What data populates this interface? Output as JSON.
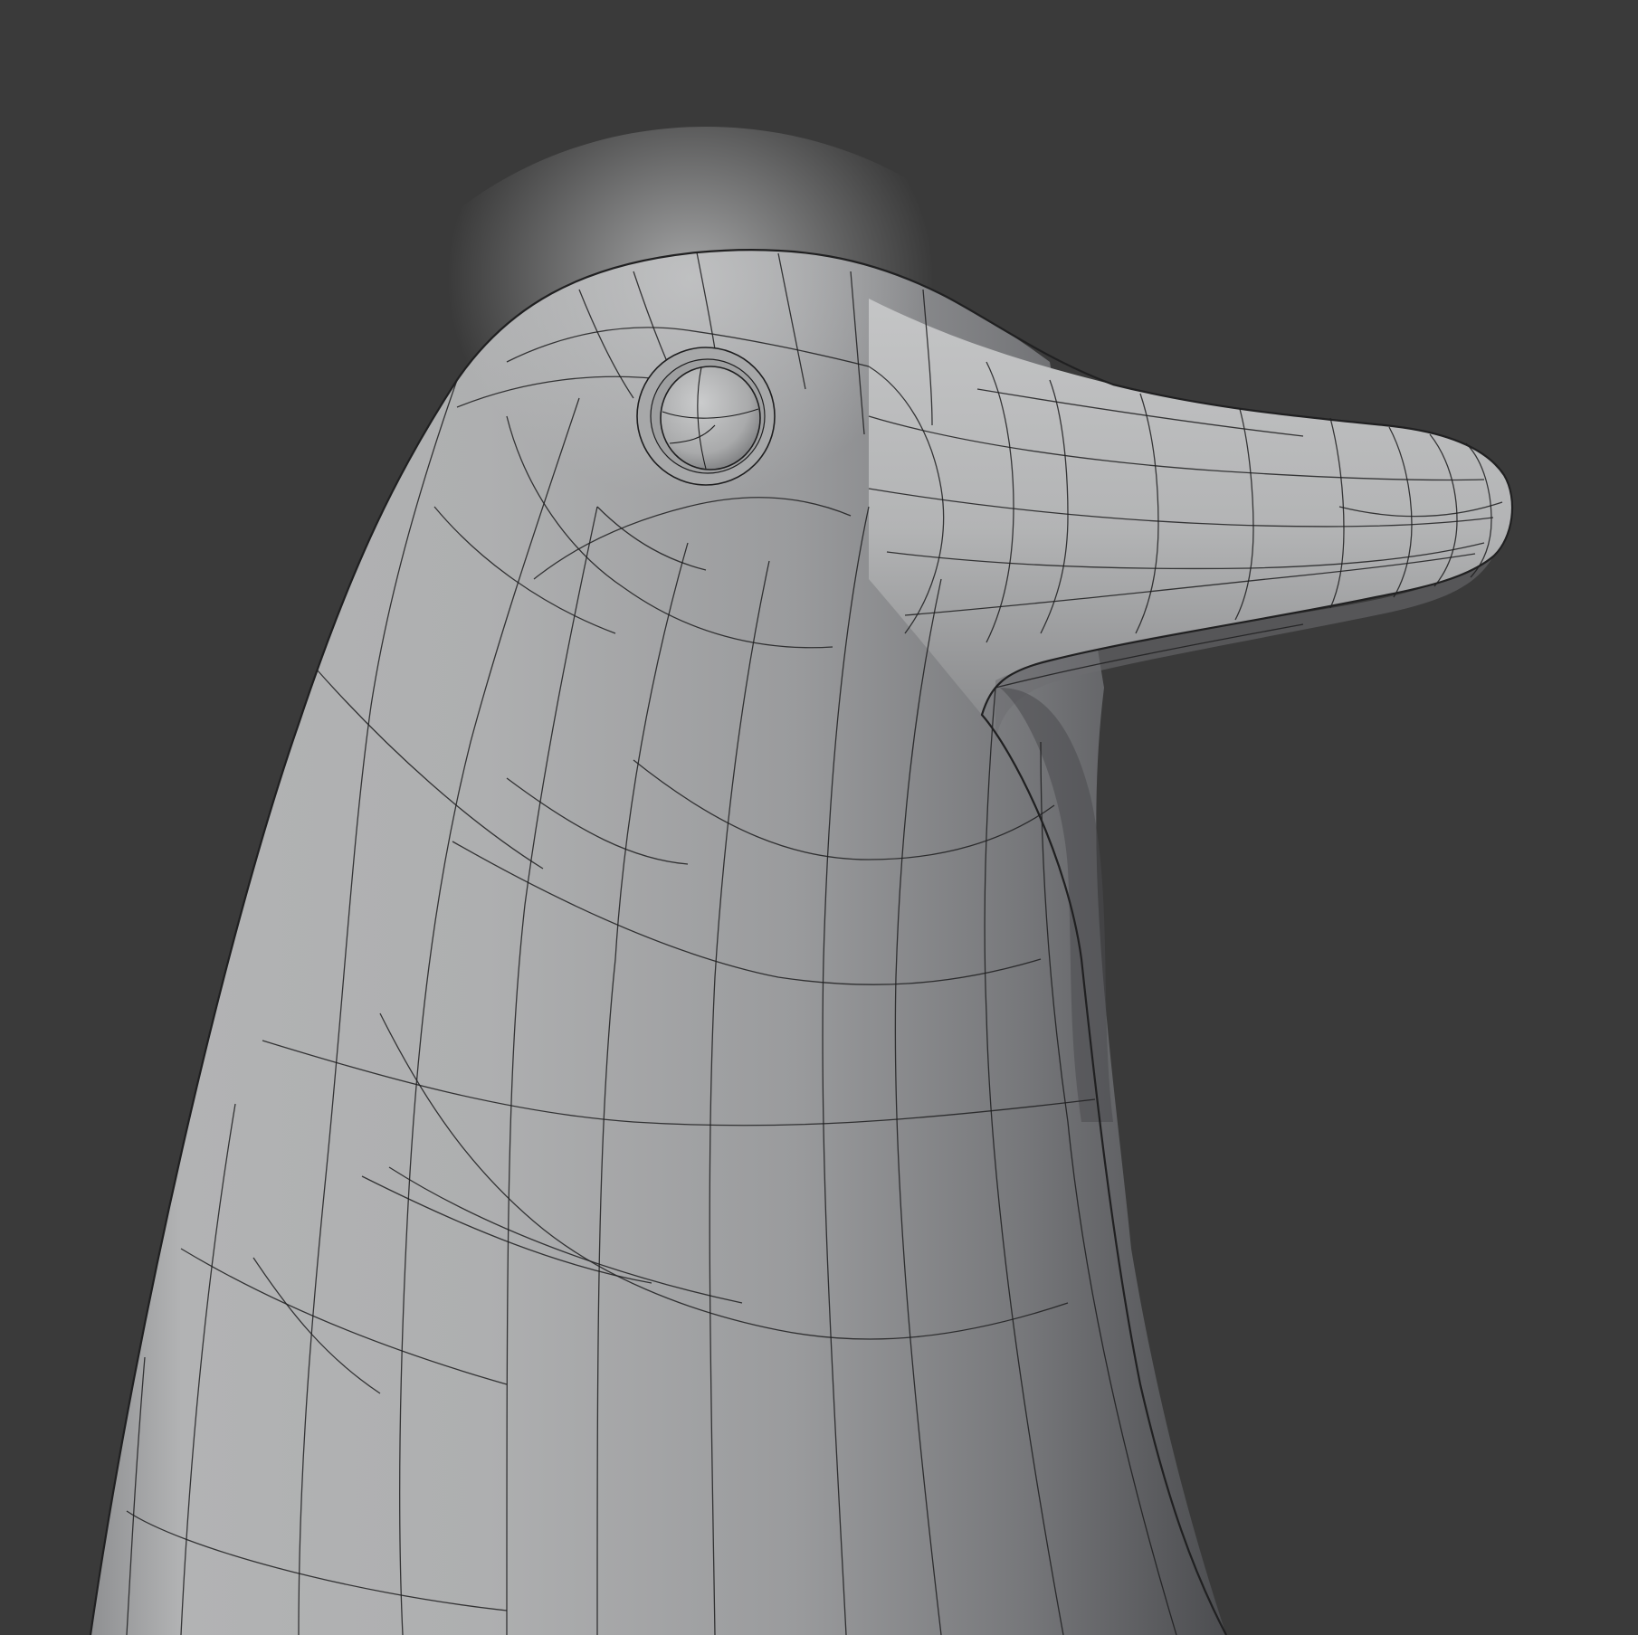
{
  "viewport": {
    "background": "#3a3a3a",
    "mesh_fill_light": "#b8b9ba",
    "mesh_fill_dark": "#55565a",
    "wire_color": "#1a1a1a"
  },
  "scene": {
    "object": "bird-figurine-mesh",
    "shading": "solid",
    "overlay": "wireframe"
  }
}
